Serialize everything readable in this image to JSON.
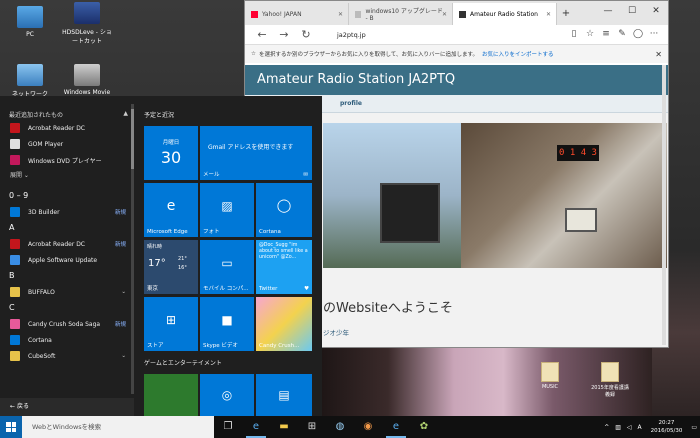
{
  "desktop": {
    "icons": [
      {
        "label": "PC"
      },
      {
        "label": "HDSDLeve - ショートカット"
      },
      {
        "label": "ネットワーク"
      },
      {
        "label": "Windows Movie Maker"
      }
    ],
    "files": [
      {
        "label": "MUSIC"
      },
      {
        "label": "2015年度看護講義録"
      }
    ]
  },
  "start_menu": {
    "recent_heading": "最近追加されたもの",
    "recent_apps": [
      "Acrobat Reader DC",
      "GOM Player",
      "Windows DVD プレイヤー"
    ],
    "expand_label": "展開",
    "sections": [
      {
        "letter": "0 – 9",
        "apps": [
          {
            "name": "3D Builder",
            "new": "新規"
          }
        ]
      },
      {
        "letter": "A",
        "apps": [
          {
            "name": "Acrobat Reader DC",
            "new": "新規"
          },
          {
            "name": "Apple Software Update",
            "new": ""
          }
        ]
      },
      {
        "letter": "B",
        "apps": [
          {
            "name": "BUFFALO",
            "new": ""
          }
        ]
      },
      {
        "letter": "C",
        "apps": [
          {
            "name": "Candy Crush Soda Saga",
            "new": "新規"
          },
          {
            "name": "Cortana",
            "new": ""
          },
          {
            "name": "CubeSoft",
            "new": ""
          }
        ]
      }
    ],
    "back_label": "戻る",
    "tiles_heading": "予定と近況",
    "games_heading": "ゲームとエンターテイメント",
    "tiles": {
      "calendar_day": "月曜日",
      "calendar_date": "30",
      "mail_text": "Gmail アドレスを使用できます",
      "mail_label": "メール",
      "edge_label": "Microsoft Edge",
      "photos_label": "フォト",
      "cortana_label": "Cortana",
      "weather_condition": "晴れ時",
      "weather_temp": "17°",
      "weather_hi": "21°",
      "weather_lo": "16°",
      "weather_city": "東京",
      "connect_label": "モバイル コンパ...",
      "twitter_text": "@Doc_Sugg \"im about to smell like a unicorn\" @Zo...",
      "twitter_label": "Twitter",
      "store_label": "ストア",
      "skype_label": "Skype ビデオ",
      "candy_label": "Candy Crush..."
    }
  },
  "browser": {
    "tabs": [
      {
        "label": "Yahoo! JAPAN"
      },
      {
        "label": "windows10 アップグレード - B"
      },
      {
        "label": "Amateur Radio Station"
      }
    ],
    "url": "ja2ptq.jp",
    "favbar_text": "を選択するか別のブラウザーからお気に入りを取得して、お気に入りバーに追加します。",
    "favbar_link": "お気に入りをインポートする",
    "site_title": "Amateur Radio Station JA2PTQ",
    "nav_item": "profile",
    "rig_display": "0 1 4 3",
    "welcome_text": "のWebsiteへようこそ",
    "sub_text": "ジオ少年"
  },
  "taskbar": {
    "search_placeholder": "WebとWindowsを検索",
    "time": "20:27",
    "date": "2016/05/30",
    "ime": "A"
  }
}
